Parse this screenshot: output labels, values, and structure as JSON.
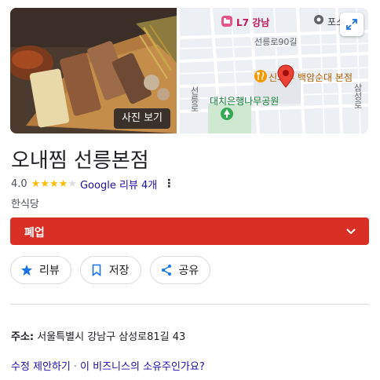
{
  "hero": {
    "photo_button_label": "사진 보기",
    "map": {
      "labels": {
        "l7": "L7 강남",
        "posco": "포스코센",
        "road_90": "선릉로90길",
        "restaurant": "신의주 백암순대 본점",
        "park": "대치은행나무공원",
        "seolleung_ro": "선릉로",
        "samseong_ro": "삼성로"
      }
    }
  },
  "business": {
    "name": "오내찜 선릉본점",
    "rating": "4.0",
    "stars": [
      1,
      1,
      1,
      1,
      0
    ],
    "reviews_label": "Google 리뷰 4개",
    "category": "한식당",
    "status": "폐업",
    "status_color": "#d93025"
  },
  "actions": {
    "review": "리뷰",
    "save": "저장",
    "share": "공유"
  },
  "details": {
    "address_label": "주소:",
    "address_value": "서울특별시 강남구 삼성로81길 43"
  },
  "footer": {
    "suggest_edit": "수정 제안하기",
    "separator": "·",
    "own_business": "이 비즈니스의 소유주인가요?"
  },
  "colors": {
    "link": "#1a0dab",
    "star": "#fbbc04",
    "accent_blue": "#1a73e8",
    "map_bg": "#eceff3"
  }
}
